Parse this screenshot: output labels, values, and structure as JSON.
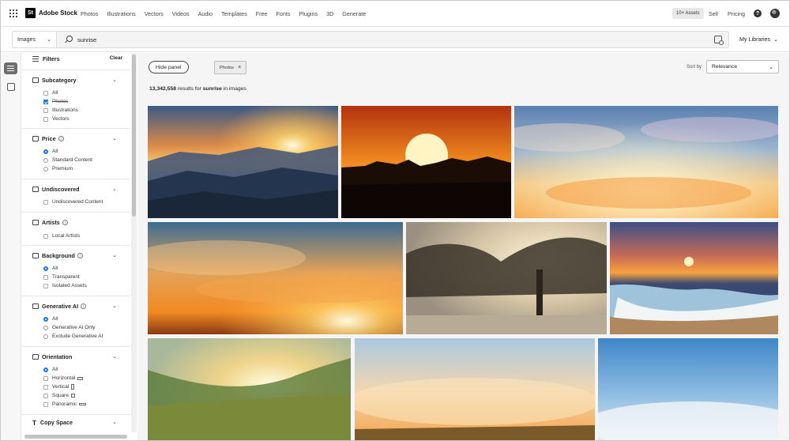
{
  "header": {
    "logo_badge": "St",
    "logo_text": "Adobe Stock",
    "nav": [
      "Photos",
      "Illustrations",
      "Vectors",
      "Videos",
      "Audio",
      "Templates",
      "Free",
      "Fonts",
      "Plugins",
      "3D",
      "Generate"
    ],
    "assets_badge": "10+ Assets",
    "sell": "Sell",
    "pricing": "Pricing",
    "help": "?"
  },
  "search": {
    "scope": "Images",
    "query": "sunrise",
    "libraries": "My Libraries"
  },
  "filters": {
    "title": "Filters",
    "clear": "Clear",
    "subcategory": {
      "title": "Subcategory",
      "options": [
        "All",
        "Photos",
        "Illustrations",
        "Vectors"
      ]
    },
    "price": {
      "title": "Price",
      "options": [
        "All",
        "Standard Content",
        "Premium"
      ]
    },
    "undiscovered": {
      "title": "Undiscovered",
      "options": [
        "Undiscovered Content"
      ]
    },
    "artists": {
      "title": "Artists",
      "options": [
        "Local Artists"
      ]
    },
    "background": {
      "title": "Background",
      "options": [
        "All",
        "Transparent",
        "Isolated Assets"
      ]
    },
    "generative_ai": {
      "title": "Generative AI",
      "options": [
        "All",
        "Generative AI Only",
        "Exclude Generative AI"
      ]
    },
    "orientation": {
      "title": "Orientation",
      "options": [
        "All",
        "Horizontal",
        "Vertical",
        "Square",
        "Panoramic"
      ]
    },
    "copy_space": {
      "title": "Copy Space"
    }
  },
  "main": {
    "hide_panel": "Hide panel",
    "chip": "Photos",
    "sort_label": "Sort by",
    "sort_value": "Relevance",
    "results_count": "13,342,558",
    "results_mid": "results for",
    "results_query": "sunrise",
    "results_tail": "in images"
  },
  "colors": {
    "accent": "#1a73e8",
    "panel_bg": "#f5f5f5"
  }
}
